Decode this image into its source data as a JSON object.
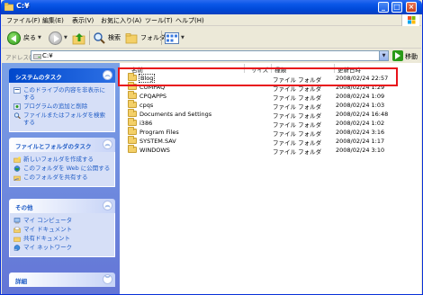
{
  "window": {
    "title": "C:¥"
  },
  "menu": [
    "ファイル(F)",
    "編集(E)",
    "表示(V)",
    "お気に入り(A)",
    "ツール(T)",
    "ヘルプ(H)"
  ],
  "toolbar": {
    "back_label": "戻る",
    "search_label": "検索",
    "folders_label": "フォルダ"
  },
  "address": {
    "label": "アドレス(D)",
    "value": "C:¥",
    "go_label": "移動"
  },
  "left": {
    "system_tasks": {
      "title": "システムのタスク",
      "items": [
        "このドライブの内容を非表示にする",
        "プログラムの追加と削除",
        "ファイルまたはフォルダを検索する"
      ]
    },
    "file_tasks": {
      "title": "ファイルとフォルダのタスク",
      "items": [
        "新しいフォルダを作成する",
        "このフォルダを Web に公開する",
        "このフォルダを共有する"
      ]
    },
    "other": {
      "title": "その他",
      "items": [
        "マイ コンピュータ",
        "マイ ドキュメント",
        "共有ドキュメント",
        "マイ ネットワーク"
      ]
    },
    "details": {
      "title": "詳細"
    }
  },
  "columns": {
    "name": "名前",
    "size": "サイズ",
    "type": "種類",
    "modified": "更新日時"
  },
  "files": [
    {
      "name": "Blog",
      "type": "ファイル フォルダ",
      "date": "2008/02/24 22:57"
    },
    {
      "name": "COMPAQ",
      "type": "ファイル フォルダ",
      "date": "2008/02/24 1:29"
    },
    {
      "name": "CPQAPPS",
      "type": "ファイル フォルダ",
      "date": "2008/02/24 1:09"
    },
    {
      "name": "cpqs",
      "type": "ファイル フォルダ",
      "date": "2008/02/24 1:03"
    },
    {
      "name": "Documents and Settings",
      "type": "ファイル フォルダ",
      "date": "2008/02/24 16:48"
    },
    {
      "name": "i386",
      "type": "ファイル フォルダ",
      "date": "2008/02/24 1:02"
    },
    {
      "name": "Program Files",
      "type": "ファイル フォルダ",
      "date": "2008/02/24 3:16"
    },
    {
      "name": "SYSTEM.SAV",
      "type": "ファイル フォルダ",
      "date": "2008/02/24 1:17"
    },
    {
      "name": "WINDOWS",
      "type": "ファイル フォルダ",
      "date": "2008/02/24 3:10"
    }
  ],
  "colors": {
    "title_bar": "#0a57e8",
    "task_pane": "#7ba2e7",
    "highlight": "#e8121a",
    "link": "#215dc6"
  }
}
